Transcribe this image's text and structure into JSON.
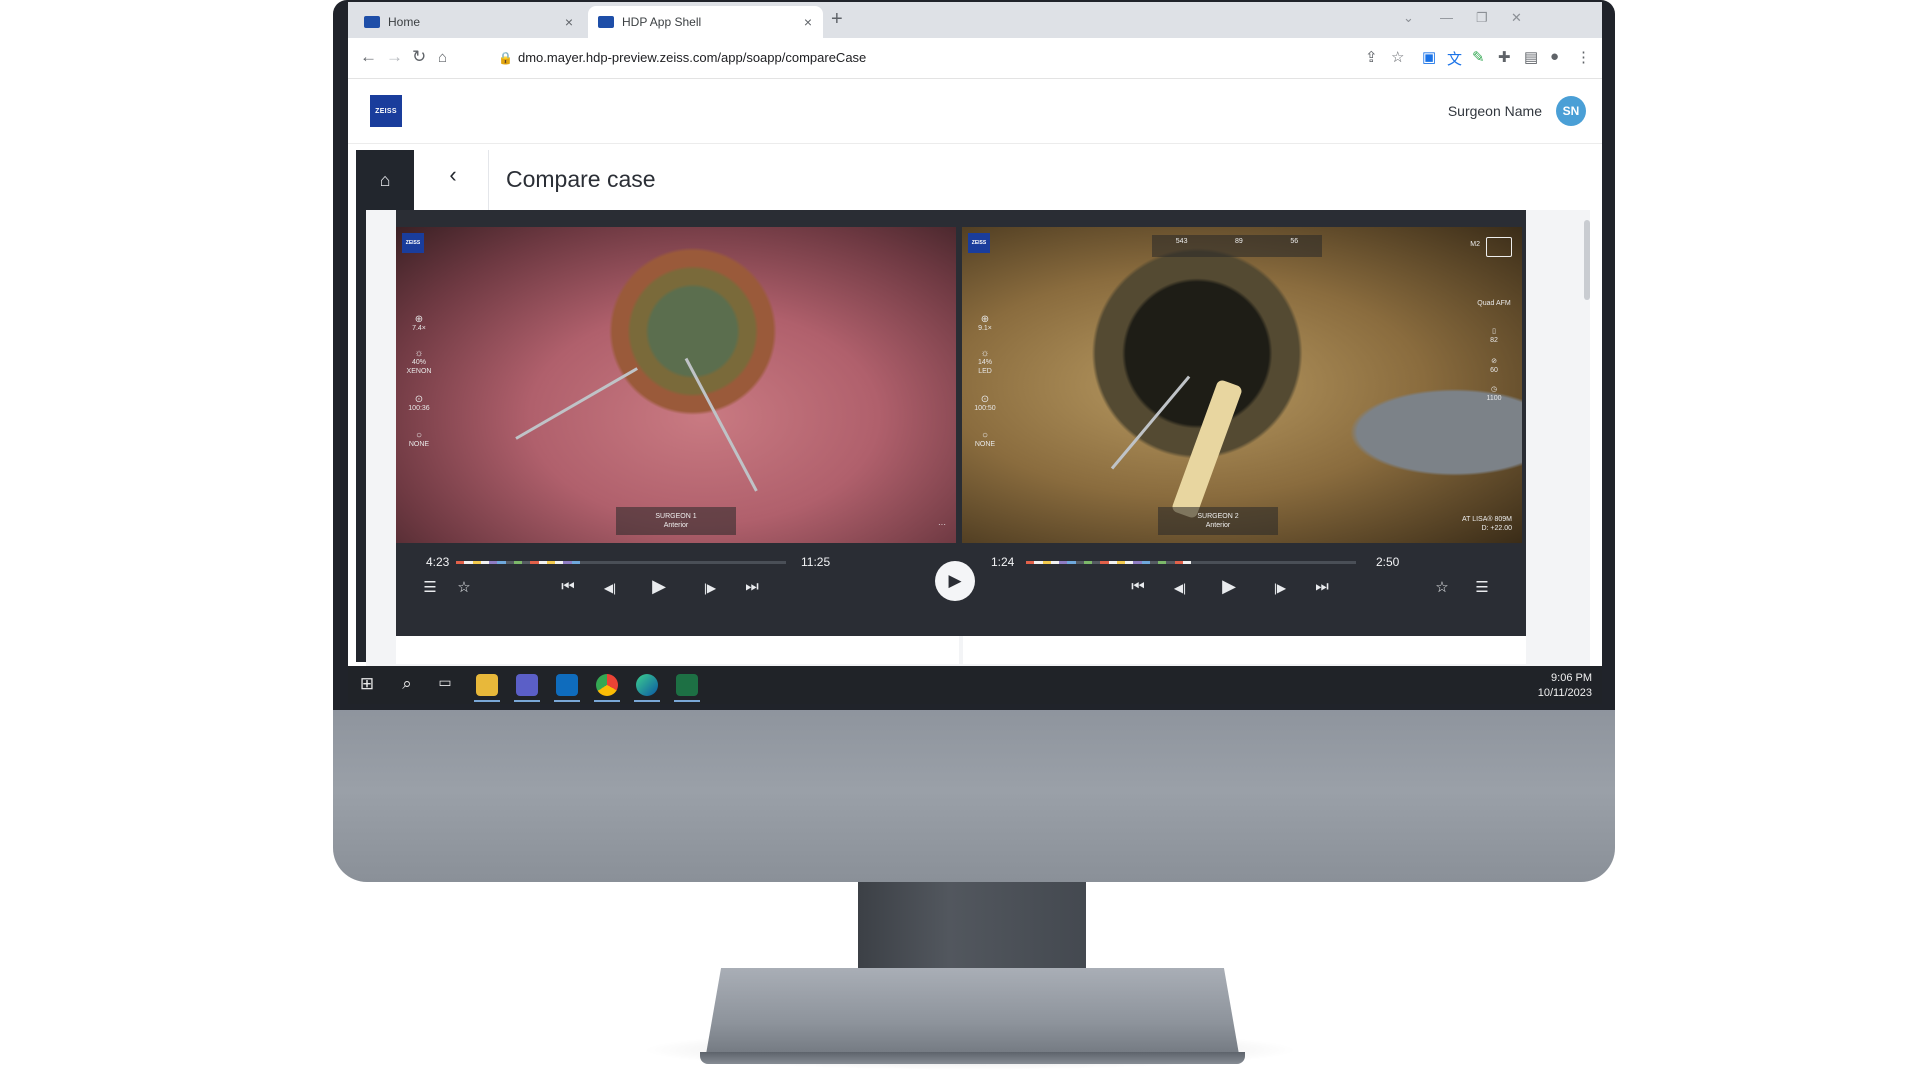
{
  "browser": {
    "tabs": [
      {
        "label": "Home",
        "close": "×"
      },
      {
        "label": "HDP App Shell",
        "close": "×"
      }
    ],
    "new_tab": "+",
    "url": "dmo.mayer.hdp-preview.zeiss.com/app/soapp/compareCase"
  },
  "header": {
    "logo_text": "ZEISS",
    "user_name": "Surgeon Name",
    "user_initials": "SN"
  },
  "sidebar": {
    "items": [
      "home-icon",
      "play-icon",
      "analytics-icon",
      "users-icon",
      "comments-icon"
    ],
    "expand": "expand-icon"
  },
  "page": {
    "title": "Compare case",
    "back": "‹"
  },
  "left_video": {
    "logo_text": "ZEISS",
    "overlay": {
      "zoom": "7.4×",
      "light": "40%",
      "light_source": "XENON",
      "focus": "100:36",
      "filter": "NONE"
    },
    "surgeon_label": "SURGEON 1",
    "surgeon_sub": "Anterior",
    "corner_mark": "···",
    "current_time": "4:23",
    "total_time": "11:25"
  },
  "right_video": {
    "logo_text": "ZEISS",
    "overlay": {
      "zoom": "9.1×",
      "light": "14%",
      "light_source": "LED",
      "focus": "100:50",
      "filter": "NONE"
    },
    "top_metrics": [
      "543",
      "89",
      "56"
    ],
    "lens_label": "M2",
    "right_overlay": [
      "Quad AFM",
      "82",
      "60",
      "1100"
    ],
    "lens_text": "AT LISA® 809M",
    "lens_power": "D: +22.00",
    "surgeon_label": "SURGEON 2",
    "surgeon_sub": "Anterior",
    "current_time": "1:24",
    "total_time": "2:50"
  },
  "progress": {
    "left": 0.37,
    "right": 0.49
  },
  "controls": {
    "list": "☰",
    "favorite": "☆",
    "skip_back": "⏮",
    "step_back": "◀|",
    "play": "▶",
    "step_forward": "|▶",
    "skip_forward": "⏭",
    "center_play": "▶"
  },
  "taskbar": {
    "time": "9:06 PM",
    "date": "10/11/2023"
  },
  "colors": {
    "brand": "#1a3d9c",
    "avatar": "#4a9fd6",
    "sidebar": "#22262d",
    "player": "#2a2d34"
  }
}
